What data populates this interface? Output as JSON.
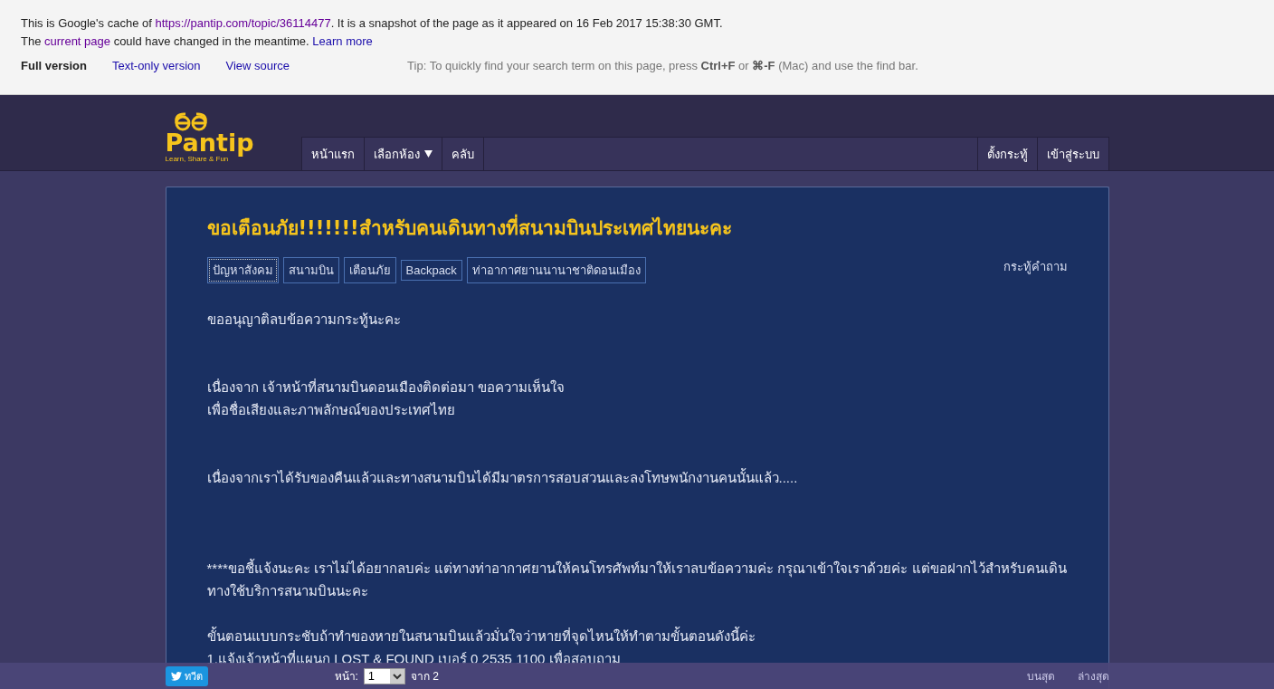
{
  "cache_notice": {
    "line1": {
      "before": "This is Google's cache of ",
      "link": "https://pantip.com/topic/36114477",
      "after": ". It is a snapshot of the page as it appeared on 16 Feb 2017 15:38:30 GMT."
    },
    "line2": {
      "before": "The ",
      "link": "current page",
      "after": " could have changed in the meantime. ",
      "link2": "Learn more"
    },
    "versions": [
      {
        "label": "Full version",
        "selected": true
      },
      {
        "label": "Text-only version",
        "selected": false
      },
      {
        "label": "View source",
        "selected": false
      }
    ],
    "tip": "Tip: To quickly find your search term on this page, press **Ctrl+F** or **⌘-F** (Mac) and use the find bar."
  },
  "site": {
    "logo": "Pantip",
    "tagline": "Learn, Share & Fun",
    "nav_left": [
      {
        "label": "หน้าแรก",
        "dropdown": false
      },
      {
        "label": "เลือกห้อง",
        "dropdown": true
      },
      {
        "label": "คลับ",
        "dropdown": false
      }
    ],
    "nav_right": [
      "ตั้งกระทู้",
      "เข้าสู่ระบบ"
    ]
  },
  "topic": {
    "title": "ขอเตือนภัย!!!!!!!สำหรับคนเดินทางที่สนามบินประเทศไทยนะคะ",
    "type": "กระทู้คำถาม",
    "tags": [
      {
        "label": "ปัญหาสังคม",
        "selected": true
      },
      {
        "label": "สนามบิน",
        "selected": false
      },
      {
        "label": "เตือนภัย",
        "selected": false
      },
      {
        "label": "Backpack",
        "selected": false
      },
      {
        "label": "ท่าอากาศยานนานาชาติดอนเมือง",
        "selected": false
      }
    ],
    "paragraphs": [
      [
        "ขออนุญาติลบข้อความกระทู้นะคะ"
      ],
      [
        "เนื่องจาก เจ้าหน้าที่สนามบินดอนเมืองติดต่อมา ขอความเห็นใจ",
        "เพื่อชื่อเสียงและภาพลักษณ์ของประเทศไทย"
      ],
      [
        "เนื่องจากเราได้รับของคืนแล้วและทางสนามบินได้มีมาตรการสอบสวนและลงโทษพนักงานคนนั้นแล้ว....."
      ],
      [
        "****ขอชี้แจ้งนะคะ เราไม่ได้อยากลบค่ะ แต่ทางท่าอากาศยานให้คนโทรศัพท์มาให้เราลบข้อความค่ะ กรุณาเข้าใจเราด้วยค่ะ  แต่ขอฝากไว้สำหรับคนเดินทางใช้บริการสนามบินนะคะ"
      ],
      [
        "ขั้นตอนแบบกระชับถ้าทำของหายในสนามบินแล้วมั่นใจว่าหายที่จุดไหนให้ทำตามขั้นตอนดังนี้ค่ะ",
        "1.แจ้งเจ้าหน้าที่แผนก LOST & FOUND เบอร์ 0 2535 1100 เพื่อสอบถาม"
      ]
    ]
  },
  "bottom_bar": {
    "share": "ทวีต",
    "page_label": "หน้า:",
    "page_value": "1",
    "page_total": "จาก 2",
    "links": [
      "บนสุด",
      "ล่างสุด"
    ]
  }
}
